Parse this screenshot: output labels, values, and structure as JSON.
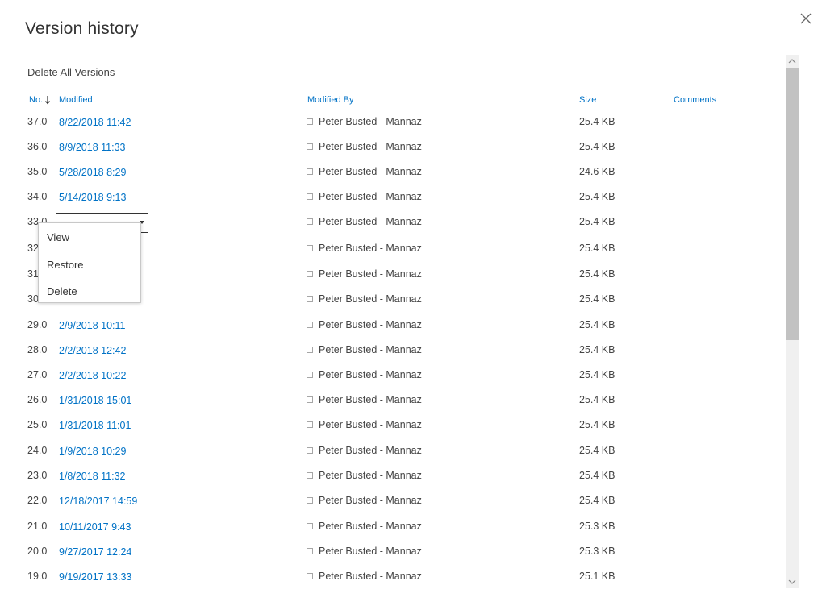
{
  "panel": {
    "title": "Version history",
    "delete_all_label": "Delete All Versions"
  },
  "table": {
    "columns": {
      "no": "No.",
      "modified": "Modified",
      "modified_by": "Modified By",
      "size": "Size",
      "comments": "Comments"
    },
    "rows": [
      {
        "no": "37.0",
        "modified": "8/22/2018 11:42",
        "by": "Peter Busted - Mannaz",
        "size": "25.4 KB"
      },
      {
        "no": "36.0",
        "modified": "8/9/2018 11:33",
        "by": "Peter Busted - Mannaz",
        "size": "25.4 KB"
      },
      {
        "no": "35.0",
        "modified": "5/28/2018 8:29",
        "by": "Peter Busted - Mannaz",
        "size": "24.6 KB"
      },
      {
        "no": "34.0",
        "modified": "5/14/2018 9:13",
        "by": "Peter Busted - Mannaz",
        "size": "25.4 KB"
      },
      {
        "no": "33.0",
        "modified": "",
        "by": "Peter Busted - Mannaz",
        "size": "25.4 KB"
      },
      {
        "no": "32",
        "modified": "",
        "by": "Peter Busted - Mannaz",
        "size": "25.4 KB"
      },
      {
        "no": "31",
        "modified": "",
        "by": "Peter Busted - Mannaz",
        "size": "25.4 KB"
      },
      {
        "no": "30",
        "modified": "",
        "by": "Peter Busted - Mannaz",
        "size": "25.4 KB"
      },
      {
        "no": "29.0",
        "modified": "2/9/2018 10:11",
        "by": "Peter Busted - Mannaz",
        "size": "25.4 KB"
      },
      {
        "no": "28.0",
        "modified": "2/2/2018 12:42",
        "by": "Peter Busted - Mannaz",
        "size": "25.4 KB"
      },
      {
        "no": "27.0",
        "modified": "2/2/2018 10:22",
        "by": "Peter Busted - Mannaz",
        "size": "25.4 KB"
      },
      {
        "no": "26.0",
        "modified": "1/31/2018 15:01",
        "by": "Peter Busted - Mannaz",
        "size": "25.4 KB"
      },
      {
        "no": "25.0",
        "modified": "1/31/2018 11:01",
        "by": "Peter Busted - Mannaz",
        "size": "25.4 KB"
      },
      {
        "no": "24.0",
        "modified": "1/9/2018 10:29",
        "by": "Peter Busted - Mannaz",
        "size": "25.4 KB"
      },
      {
        "no": "23.0",
        "modified": "1/8/2018 11:32",
        "by": "Peter Busted - Mannaz",
        "size": "25.4 KB"
      },
      {
        "no": "22.0",
        "modified": "12/18/2017 14:59",
        "by": "Peter Busted - Mannaz",
        "size": "25.4 KB"
      },
      {
        "no": "21.0",
        "modified": "10/11/2017 9:43",
        "by": "Peter Busted - Mannaz",
        "size": "25.3 KB"
      },
      {
        "no": "20.0",
        "modified": "9/27/2017 12:24",
        "by": "Peter Busted - Mannaz",
        "size": "25.3 KB"
      },
      {
        "no": "19.0",
        "modified": "9/19/2017 13:33",
        "by": "Peter Busted - Mannaz",
        "size": "25.1 KB"
      }
    ]
  },
  "context_menu": {
    "items": [
      "View",
      "Restore",
      "Delete"
    ]
  },
  "icons": {
    "close": "close-icon",
    "sort": "sort-descending-icon",
    "person": "person-presence-icon",
    "dropdown": "chevron-down-icon",
    "scroll_up": "chevron-up-icon",
    "scroll_down": "chevron-down-icon"
  },
  "colors": {
    "link": "#0072c6",
    "text": "#333333",
    "scroll_track": "#f0f0f0",
    "scroll_thumb": "#c2c2c2"
  }
}
